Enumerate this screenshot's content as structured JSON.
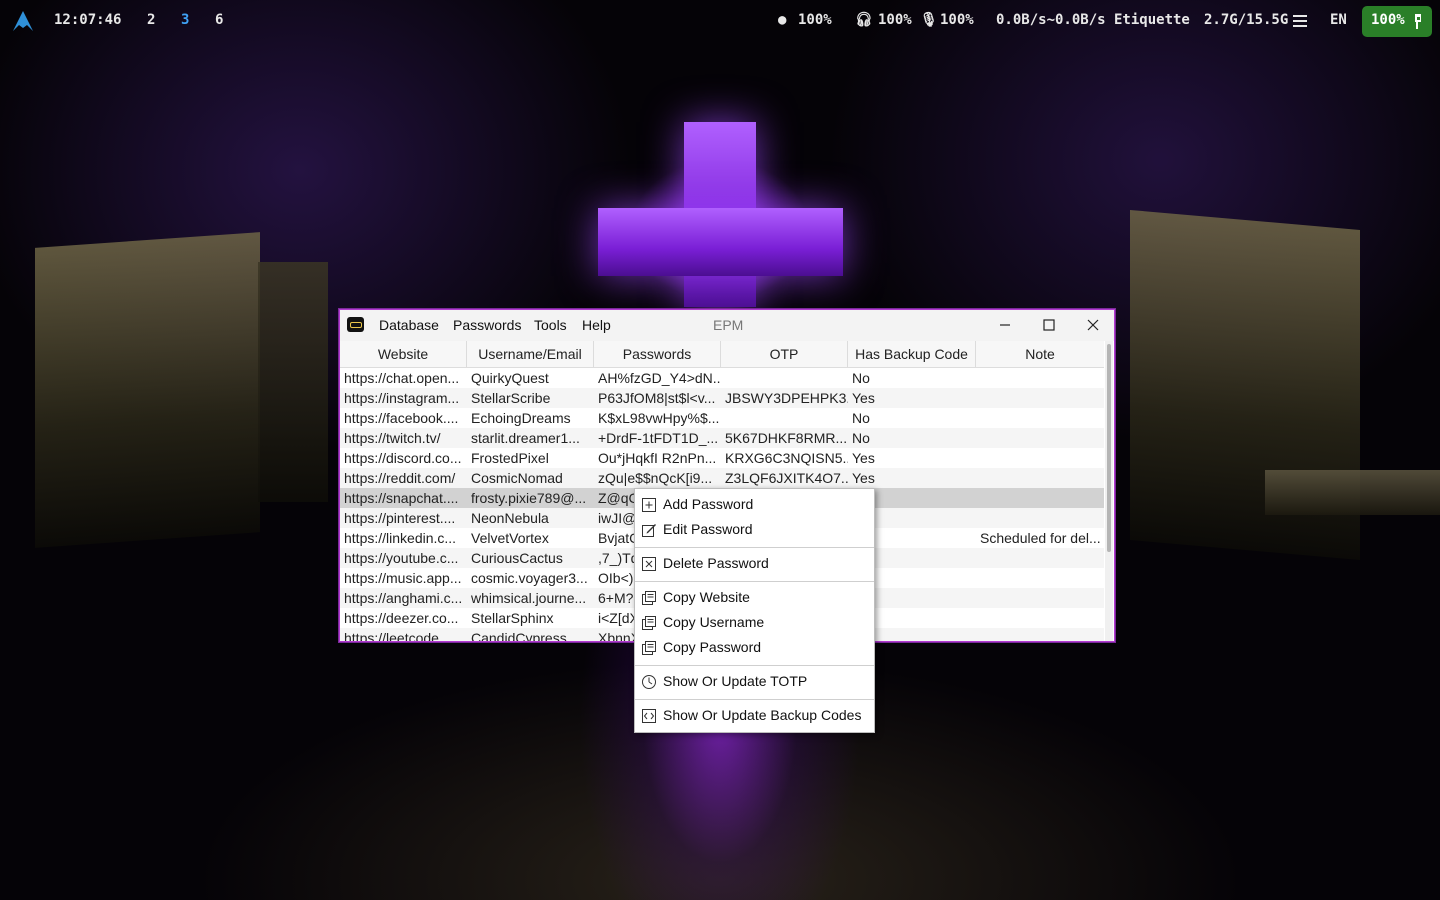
{
  "topbar": {
    "time": "12:07:46",
    "workspaces": [
      "2",
      "3",
      "6"
    ],
    "active_workspace": "3",
    "brightness": "100%",
    "headphones": "100%",
    "mic": "100%",
    "network": "0.0B/s~0.0B/s Etiquette",
    "memory": "2.7G/15.5G",
    "language": "EN",
    "battery": "100%",
    "colors": {
      "active_workspace": "#3fa2f5",
      "battery_bg": "#2a7f28"
    }
  },
  "window": {
    "title": "EPM",
    "menus": [
      "Database",
      "Passwords",
      "Tools",
      "Help"
    ],
    "columns": [
      "Website",
      "Username/Email",
      "Passwords",
      "OTP",
      "Has Backup Code",
      "Note"
    ],
    "rows": [
      [
        "https://chat.open...",
        "QuirkyQuest",
        "AH%fzGD_Y4>dN...",
        "",
        "No",
        ""
      ],
      [
        "https://instagram...",
        "StellarScribe",
        "P63JfOM8|st$l<v...",
        "JBSWY3DPEHPK3...",
        "Yes",
        ""
      ],
      [
        "https://facebook....",
        "EchoingDreams",
        "K$xL98vwHpy%$...",
        "",
        "No",
        ""
      ],
      [
        "https://twitch.tv/",
        "starlit.dreamer1...",
        "+DrdF-1tFDT1D_...",
        "5K67DHKF8RMR...",
        "No",
        ""
      ],
      [
        "https://discord.co...",
        "FrostedPixel",
        "Ou*jHqkfI R2nPn...",
        "KRXG6C3NQISN5...",
        "Yes",
        ""
      ],
      [
        "https://reddit.com/",
        "CosmicNomad",
        "zQu|e$$nQcK[i9...",
        "Z3LQF6JXITK4O7...",
        "Yes",
        ""
      ],
      [
        "https://snapchat....",
        "frosty.pixie789@...",
        "Z@qC",
        "",
        "",
        ""
      ],
      [
        "https://pinterest....",
        "NeonNebula",
        "iwJI@M",
        "",
        "",
        ""
      ],
      [
        "https://linkedin.c...",
        "VelvetVortex",
        "BvjatC",
        "",
        "",
        "Scheduled for del..."
      ],
      [
        "https://youtube.c...",
        "CuriousCactus",
        ",7_)Td",
        "",
        "",
        ""
      ],
      [
        "https://music.app...",
        "cosmic.voyager3...",
        "OIb<)",
        "",
        "",
        ""
      ],
      [
        "https://anghami.c...",
        "whimsical.journe...",
        "6+M?c",
        "",
        "",
        ""
      ],
      [
        "https://deezer.co...",
        "StellarSphinx",
        "i<Z[dX",
        "",
        "",
        ""
      ],
      [
        "https://leetcode....",
        "CandidCypress",
        "XbnnX",
        "",
        "",
        ""
      ]
    ],
    "selected_row": 6
  },
  "context_menu": {
    "items": [
      {
        "label": "Add Password",
        "icon": "add-icon"
      },
      {
        "label": "Edit Password",
        "icon": "edit-icon"
      },
      {
        "label": "Delete Password",
        "icon": "delete-icon"
      },
      {
        "label": "Copy Website",
        "icon": "copy-icon"
      },
      {
        "label": "Copy Username",
        "icon": "copy-icon"
      },
      {
        "label": "Copy Password",
        "icon": "copy-icon"
      },
      {
        "label": "Show Or Update TOTP",
        "icon": "clock-icon"
      },
      {
        "label": "Show Or Update Backup Codes",
        "icon": "code-icon"
      }
    ]
  }
}
